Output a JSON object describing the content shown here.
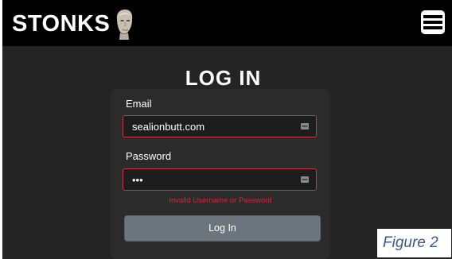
{
  "header": {
    "brand": "STONKS",
    "logo_icon": "meme-man-head-icon",
    "menu_icon": "hamburger-menu-icon"
  },
  "page": {
    "title": "LOG IN"
  },
  "form": {
    "email": {
      "label": "Email",
      "value": "sealionbutt.com",
      "icon": "autofill-key-icon"
    },
    "password": {
      "label": "Password",
      "value": "•••",
      "icon": "autofill-key-icon"
    },
    "error_message": "Invalid Username or Password",
    "submit_label": "Log In"
  },
  "caption": "Figure 2",
  "colors": {
    "navbar": "#000000",
    "background": "#242424",
    "card": "#2b2b2b",
    "input_border_error": "#c0394b",
    "error_text": "#d02a3b",
    "button": "#6c757d",
    "caption_text": "#3a5b8c"
  }
}
